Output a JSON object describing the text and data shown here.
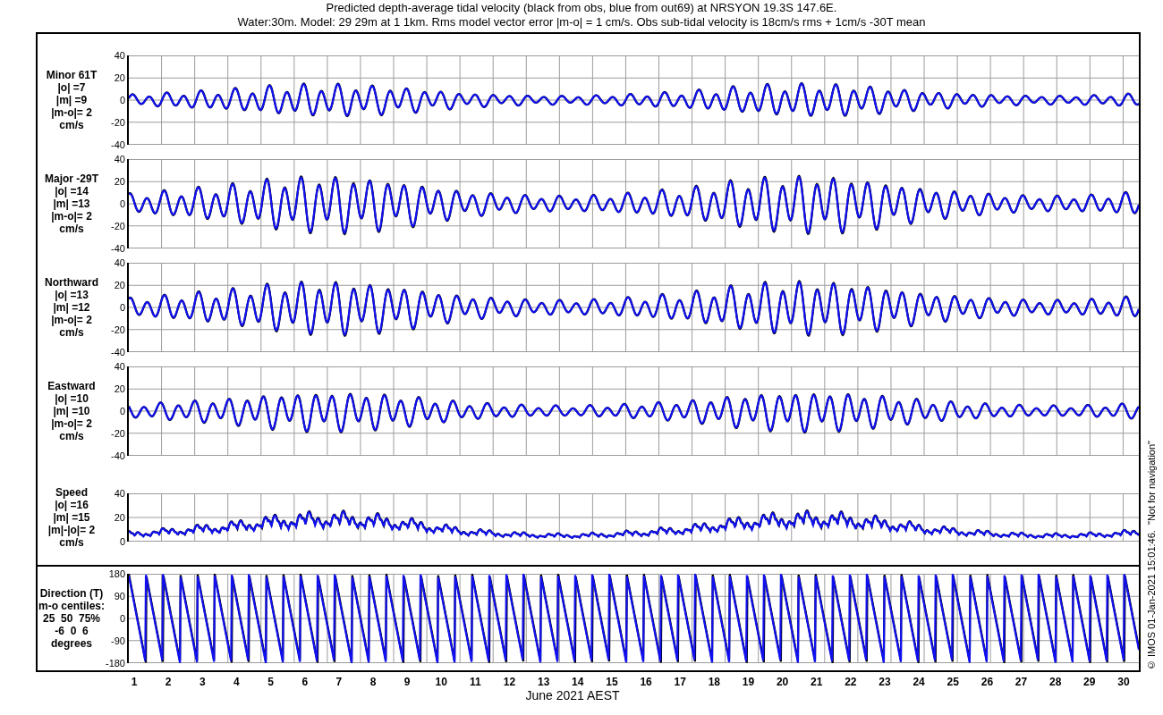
{
  "title": {
    "lines": [
      "Predicted depth-average tidal velocity (black from obs, blue from out69) at NRSYON 19.3S 147.6E.",
      "Water:30m. Model: 29 29m at 1 1km. Rms model vector error |m-o| = 1 cm/s. Obs sub-tidal velocity is 18cm/s rms + 1cm/s -30T mean"
    ]
  },
  "panels": [
    {
      "kind": "signed",
      "label_lines": [
        "Minor 61T",
        "|o| =7",
        "|m| =9",
        "|m-o|= 2",
        "cm/s"
      ],
      "yticks": [
        "40",
        "20",
        "0",
        "-20",
        "-40"
      ]
    },
    {
      "kind": "signed",
      "label_lines": [
        "Major -29T",
        "|o| =14",
        "|m| =13",
        "|m-o|= 2",
        "cm/s"
      ],
      "yticks": [
        "40",
        "20",
        "0",
        "-20",
        "-40"
      ]
    },
    {
      "kind": "signed",
      "label_lines": [
        "Northward",
        "|o| =13",
        "|m| =12",
        "|m-o|= 2",
        "cm/s"
      ],
      "yticks": [
        "40",
        "20",
        "0",
        "-20",
        "-40"
      ]
    },
    {
      "kind": "signed",
      "label_lines": [
        "Eastward",
        "|o| =10",
        "|m| =10",
        "|m-o|= 2",
        "cm/s"
      ],
      "yticks": [
        "40",
        "20",
        "0",
        "-20",
        "-40"
      ]
    },
    {
      "kind": "speed",
      "label_lines": [
        "Speed",
        "|o| =16",
        "|m| =15",
        "|m|-|o|= 2",
        "cm/s"
      ],
      "yticks": [
        "40",
        "20",
        "0"
      ]
    },
    {
      "kind": "direction",
      "label_lines": [
        "Direction (T)",
        "m-o centiles:",
        "25  50  75%",
        "-6  0  6",
        "degrees"
      ],
      "yticks": [
        "180",
        "90",
        "0",
        "-90",
        "-180"
      ]
    }
  ],
  "x_axis": {
    "day_labels": [
      "1",
      "2",
      "3",
      "4",
      "5",
      "6",
      "7",
      "8",
      "9",
      "10",
      "11",
      "12",
      "13",
      "14",
      "15",
      "16",
      "17",
      "18",
      "19",
      "20",
      "21",
      "22",
      "23",
      "24",
      "25",
      "26",
      "27",
      "28",
      "29",
      "30"
    ],
    "label": "June 2021 AEST"
  },
  "credit": "© IMOS 01-Jan-2021 15:01:46.  \"Not for navigation\""
}
